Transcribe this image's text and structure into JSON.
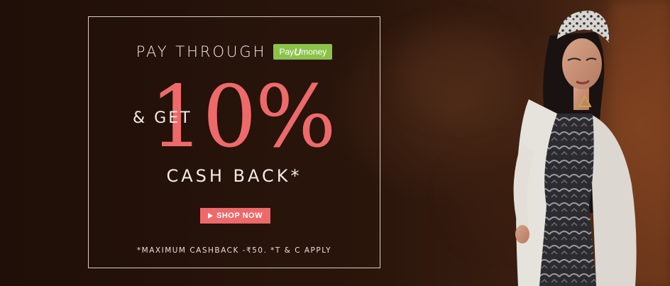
{
  "promo": {
    "pay_through": "PAY THROUGH",
    "payu_badge_pre": "Pay",
    "payu_badge_u": "U",
    "payu_badge_post": "money",
    "and_get": "& GET",
    "discount": "10%",
    "cashback": "CASH BACK*",
    "shop_now": "SHOP NOW",
    "terms": "*MAXIMUM CASHBACK -₹50. *T & C APPLY"
  },
  "colors": {
    "accent": "#ee6a6a",
    "payu_green": "#8bc34a",
    "text_light": "#f3ece6",
    "background": "#2a150b"
  },
  "icons": {
    "shop_now_icon": "play-icon"
  }
}
